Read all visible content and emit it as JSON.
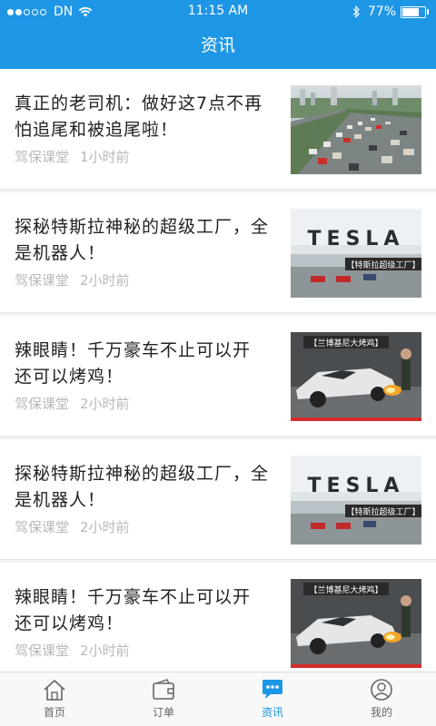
{
  "status": {
    "carrier": "DN",
    "time": "11:15 AM",
    "battery": "77%",
    "battery_level": 0.77,
    "signal_bars": 2
  },
  "header": {
    "title": "资讯"
  },
  "news": [
    {
      "title": "真正的老司机：做好这7点不再怕追尾和被追尾啦！",
      "source": "驾保课堂",
      "time": "1小时前",
      "thumb": "traffic"
    },
    {
      "title": "探秘特斯拉神秘的超级工厂，全是机器人！",
      "source": "驾保课堂",
      "time": "2小时前",
      "thumb": "tesla",
      "badge": "【特斯拉超级工厂】",
      "sign": "TESLA"
    },
    {
      "title": "辣眼睛！千万豪车不止可以开 还可以烤鸡！",
      "source": "驾保课堂",
      "time": "2小时前",
      "thumb": "lambo",
      "badge": "【兰博基尼大烤鸡】"
    },
    {
      "title": "探秘特斯拉神秘的超级工厂，全是机器人！",
      "source": "驾保课堂",
      "time": "2小时前",
      "thumb": "tesla",
      "badge": "【特斯拉超级工厂】",
      "sign": "TESLA"
    },
    {
      "title": "辣眼睛！千万豪车不止可以开 还可以烤鸡！",
      "source": "驾保课堂",
      "time": "2小时前",
      "thumb": "lambo",
      "badge": "【兰博基尼大烤鸡】"
    }
  ],
  "tabs": [
    {
      "label": "首页",
      "icon": "home-icon",
      "active": false
    },
    {
      "label": "订单",
      "icon": "wallet-icon",
      "active": false
    },
    {
      "label": "资讯",
      "icon": "chat-bubble-icon",
      "active": true
    },
    {
      "label": "我的",
      "icon": "user-icon",
      "active": false
    }
  ],
  "colors": {
    "primary": "#1e96e6",
    "text": "#222222",
    "meta": "#b8b8b8",
    "tab_inactive": "#666666"
  }
}
